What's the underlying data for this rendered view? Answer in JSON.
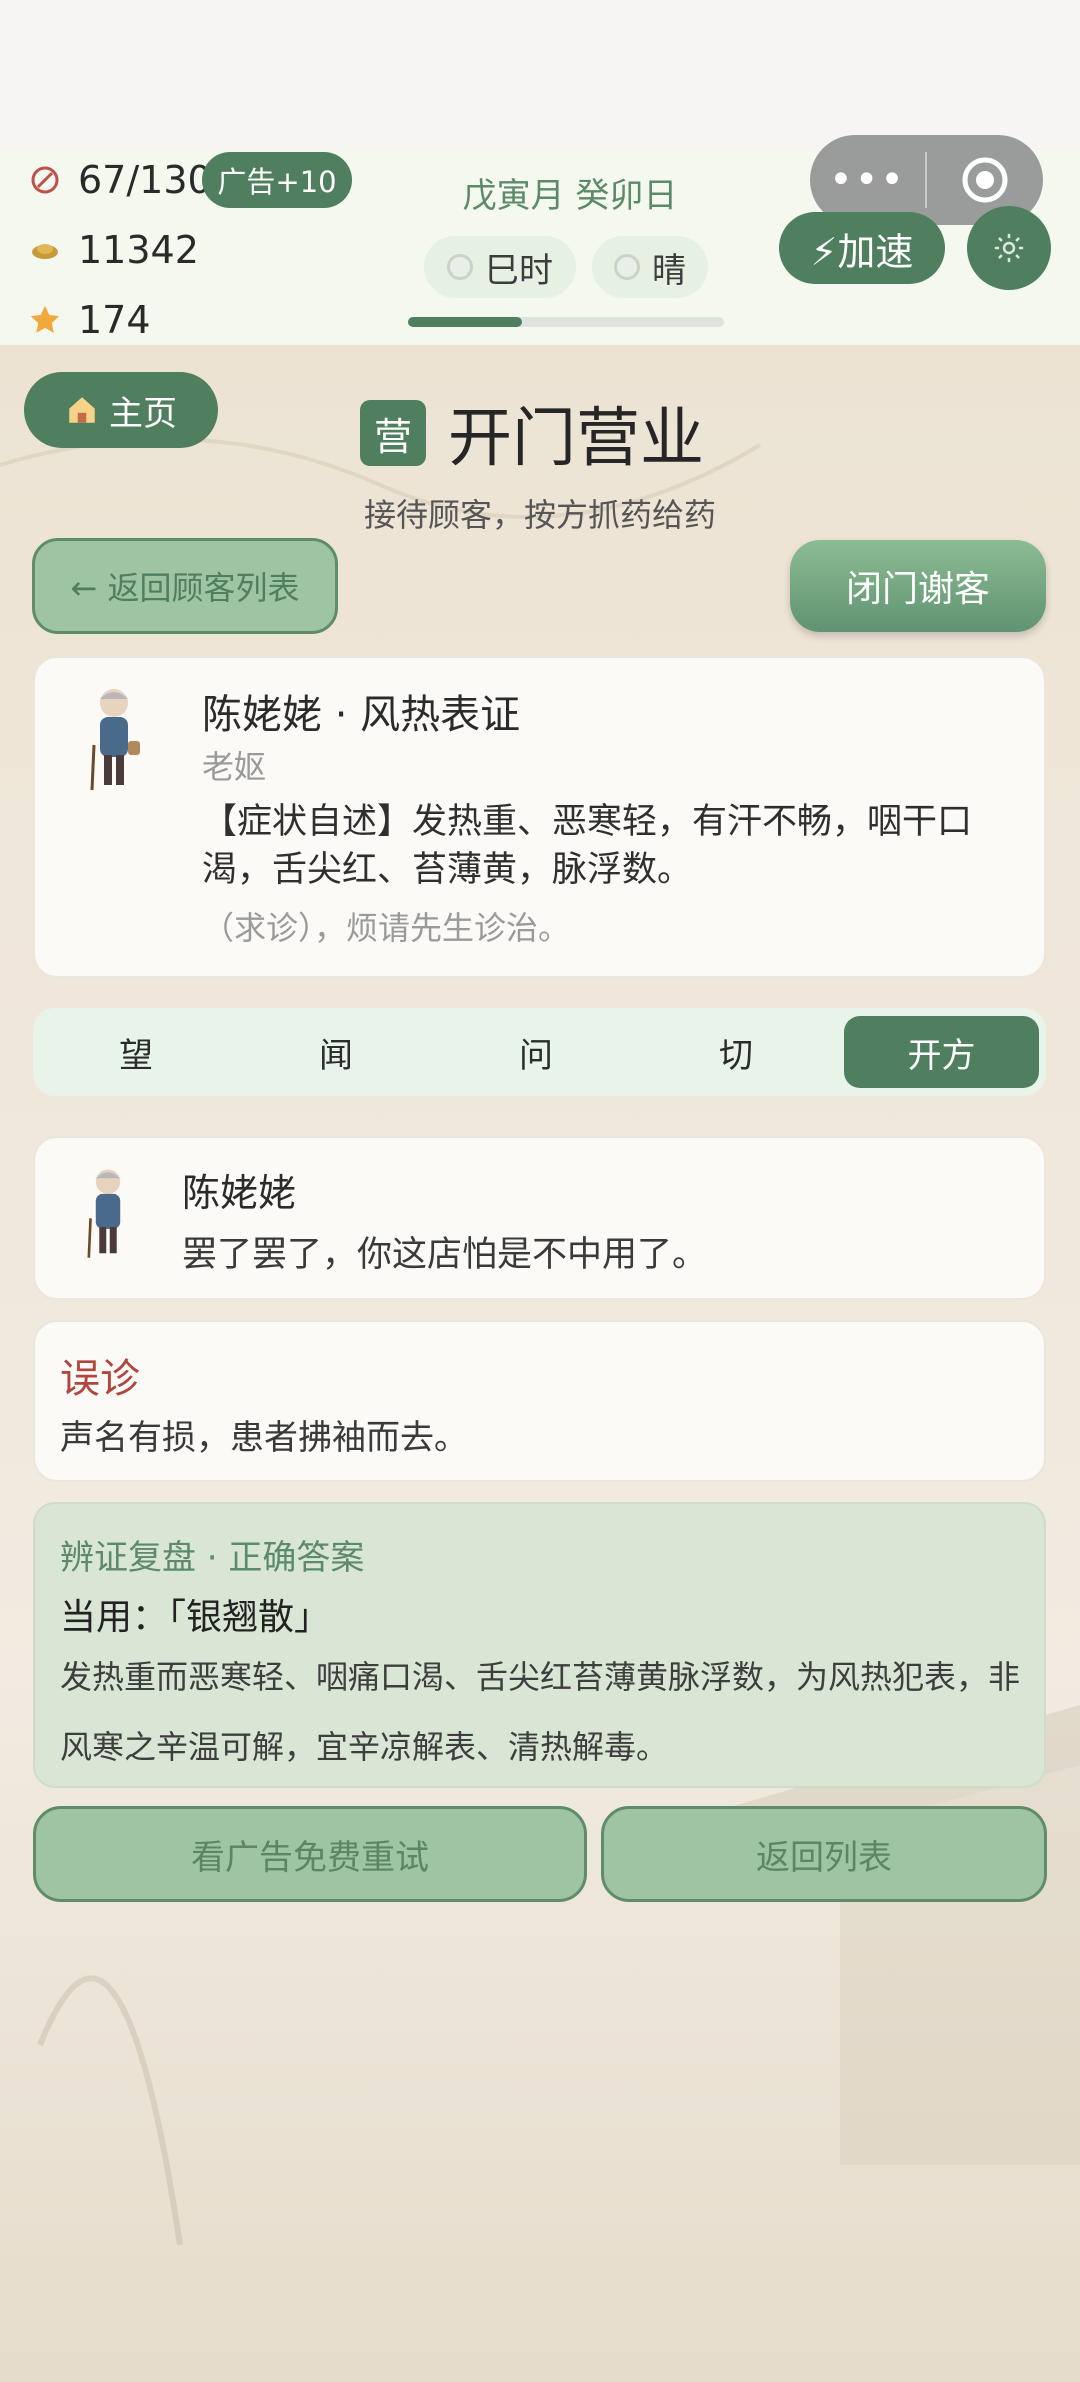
{
  "status": {
    "stamina": "67/130",
    "ad_bonus": "广告+10",
    "coins": "11342",
    "stars": "174",
    "date": "戊寅月 癸卯日",
    "time_of_day": "巳时",
    "weather": "晴",
    "day_progress": 0.36,
    "speedup_label": "⚡加速"
  },
  "capsule": {
    "menu_glyph": "•••"
  },
  "nav": {
    "home_label": "主页"
  },
  "page": {
    "badge": "营",
    "title": "开门营业",
    "subtitle": "接待顾客，按方抓药给药",
    "back_label": "← 返回顾客列表",
    "close_label": "闭门谢客"
  },
  "patient": {
    "name": "陈姥姥 · 风热表证",
    "role": "老妪",
    "symptoms": "【症状自述】发热重、恶寒轻，有汗不畅，咽干口渴，舌尖红、苔薄黄，脉浮数。",
    "request": "（求诊），烦请先生诊治。"
  },
  "tabs": [
    "望",
    "闻",
    "问",
    "切",
    "开方"
  ],
  "dialog": {
    "name": "陈姥姥",
    "text": "罢了罢了，你这店怕是不中用了。"
  },
  "result": {
    "title": "误诊",
    "text": "声名有损，患者拂袖而去。"
  },
  "review": {
    "title": "辨证复盘 · 正确答案",
    "answer": "当用：「银翘散」",
    "explain": "发热重而恶寒轻、咽痛口渴、舌尖红苔薄黄脉浮数，为风热犯表，非风寒之辛温可解，宜辛凉解表、清热解毒。"
  },
  "actions": {
    "retry_ad": "看广告免费重试",
    "back_list": "返回列表"
  },
  "colors": {
    "accent": "#4f7f5f",
    "error": "#b0463d",
    "review_bg": "#d9e6d5"
  }
}
